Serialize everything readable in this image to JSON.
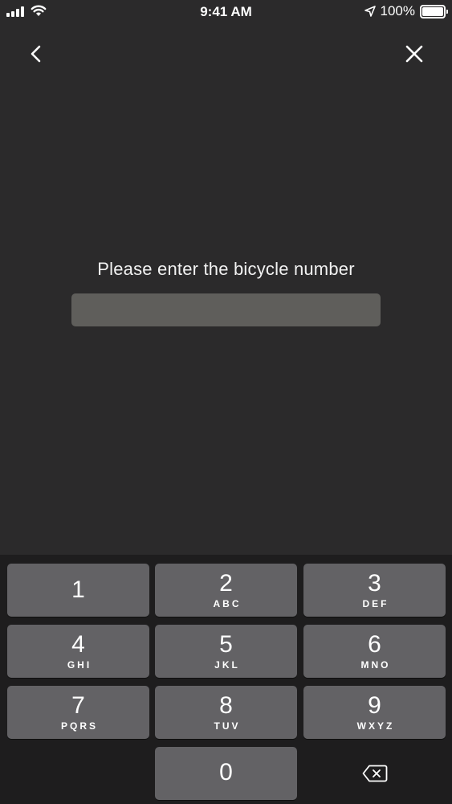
{
  "status_bar": {
    "time": "9:41 AM",
    "battery_percent": "100%",
    "battery_level": 1.0,
    "icons": [
      "signal-icon",
      "wifi-icon",
      "location-arrow-icon",
      "battery-icon"
    ]
  },
  "nav": {
    "back_icon": "chevron-left-icon",
    "close_icon": "close-icon"
  },
  "prompt": {
    "title": "Please enter the bicycle number",
    "input_value": "",
    "input_placeholder": ""
  },
  "keypad": {
    "keys": [
      {
        "digit": "1",
        "letters": ""
      },
      {
        "digit": "2",
        "letters": "ABC"
      },
      {
        "digit": "3",
        "letters": "DEF"
      },
      {
        "digit": "4",
        "letters": "GHI"
      },
      {
        "digit": "5",
        "letters": "JKL"
      },
      {
        "digit": "6",
        "letters": "MNO"
      },
      {
        "digit": "7",
        "letters": "PQRS"
      },
      {
        "digit": "8",
        "letters": "TUV"
      },
      {
        "digit": "9",
        "letters": "WXYZ"
      },
      {
        "digit": "0",
        "letters": ""
      }
    ],
    "delete_icon": "backspace-icon"
  },
  "colors": {
    "background": "#2b2a2b",
    "keypad_background": "#1e1d1e",
    "key": "#636265",
    "input": "#5f5e5b"
  }
}
